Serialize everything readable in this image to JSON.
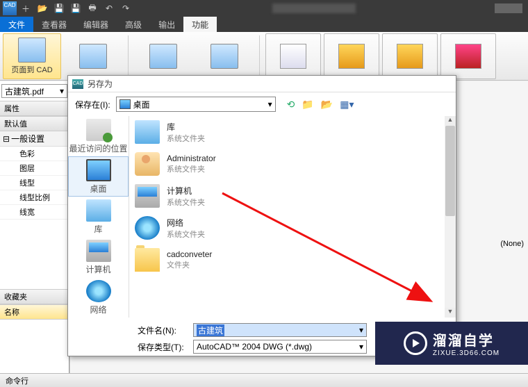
{
  "titlebar": {
    "logo": "CAD"
  },
  "menubar": {
    "items": [
      "文件",
      "查看器",
      "编辑器",
      "高级",
      "输出",
      "功能"
    ],
    "activeIndex": 0,
    "lightIndex": 5
  },
  "ribbon": {
    "btn1": "页面到 CAD"
  },
  "leftpanel": {
    "currentFile": "古建筑.pdf",
    "heads": {
      "attrs": "属性",
      "defaults": "默认值",
      "general": "一般设置",
      "favs": "收藏夹",
      "name": "名称"
    },
    "treeItems": [
      "色彩",
      "图层",
      "线型",
      "线型比例",
      "线宽"
    ],
    "minus": "⊟"
  },
  "main": {
    "none": "(None)"
  },
  "status": {
    "cmdline": "命令行"
  },
  "dialog": {
    "title": "另存为",
    "saveInLabel": "保存在(I):",
    "saveInValue": "桌面",
    "places": {
      "recent": "最近访问的位置",
      "desktop": "桌面",
      "library": "库",
      "computer": "计算机",
      "network": "网络"
    },
    "files": [
      {
        "name": "库",
        "sub": "系统文件夹",
        "icon": "lib"
      },
      {
        "name": "Administrator",
        "sub": "系统文件夹",
        "icon": "user"
      },
      {
        "name": "计算机",
        "sub": "系统文件夹",
        "icon": "pc"
      },
      {
        "name": "网络",
        "sub": "系统文件夹",
        "icon": "net"
      },
      {
        "name": "cadconveter",
        "sub": "文件夹",
        "icon": "folder"
      }
    ],
    "filenameLabel": "文件名(N):",
    "filenameValue": "古建筑",
    "filetypeLabel": "保存类型(T):",
    "filetypeValue": "AutoCAD™ 2004 DWG (*.dwg)"
  },
  "watermark": {
    "big": "溜溜自学",
    "small": "ZIXUE.3D66.COM"
  }
}
